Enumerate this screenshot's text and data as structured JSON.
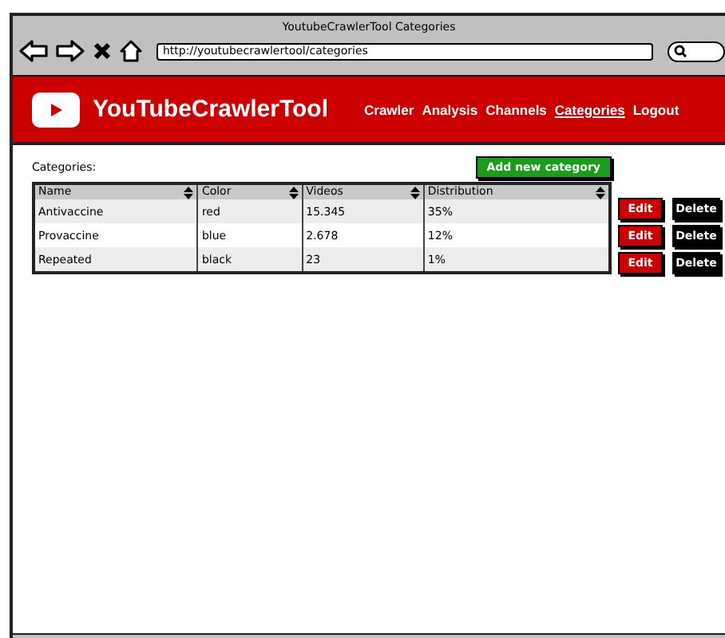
{
  "window": {
    "title": "YoutubeCrawlerTool Categories"
  },
  "address_bar": {
    "value": "http://youtubecrawlertool/categories"
  },
  "brand": "YouTubeCrawlerTool",
  "nav": [
    {
      "label": "Crawler",
      "selected": false
    },
    {
      "label": "Analysis",
      "selected": false
    },
    {
      "label": "Channels",
      "selected": false
    },
    {
      "label": "Categories",
      "selected": true
    },
    {
      "label": "Logout",
      "selected": false
    }
  ],
  "section_label": "Categories:",
  "add_button": "Add new category",
  "table": {
    "columns": [
      "Name",
      "Color",
      "Videos",
      "Distribution"
    ],
    "rows": [
      {
        "cells": [
          "Antivaccine",
          "red",
          "15.345",
          "35%"
        ],
        "edit": "Edit",
        "delete": "Delete"
      },
      {
        "cells": [
          "Provaccine",
          "blue",
          "2.678",
          "12%"
        ],
        "edit": "Edit",
        "delete": "Delete"
      },
      {
        "cells": [
          "Repeated",
          "black",
          "23",
          "1%"
        ],
        "edit": "Edit",
        "delete": "Delete"
      }
    ]
  }
}
